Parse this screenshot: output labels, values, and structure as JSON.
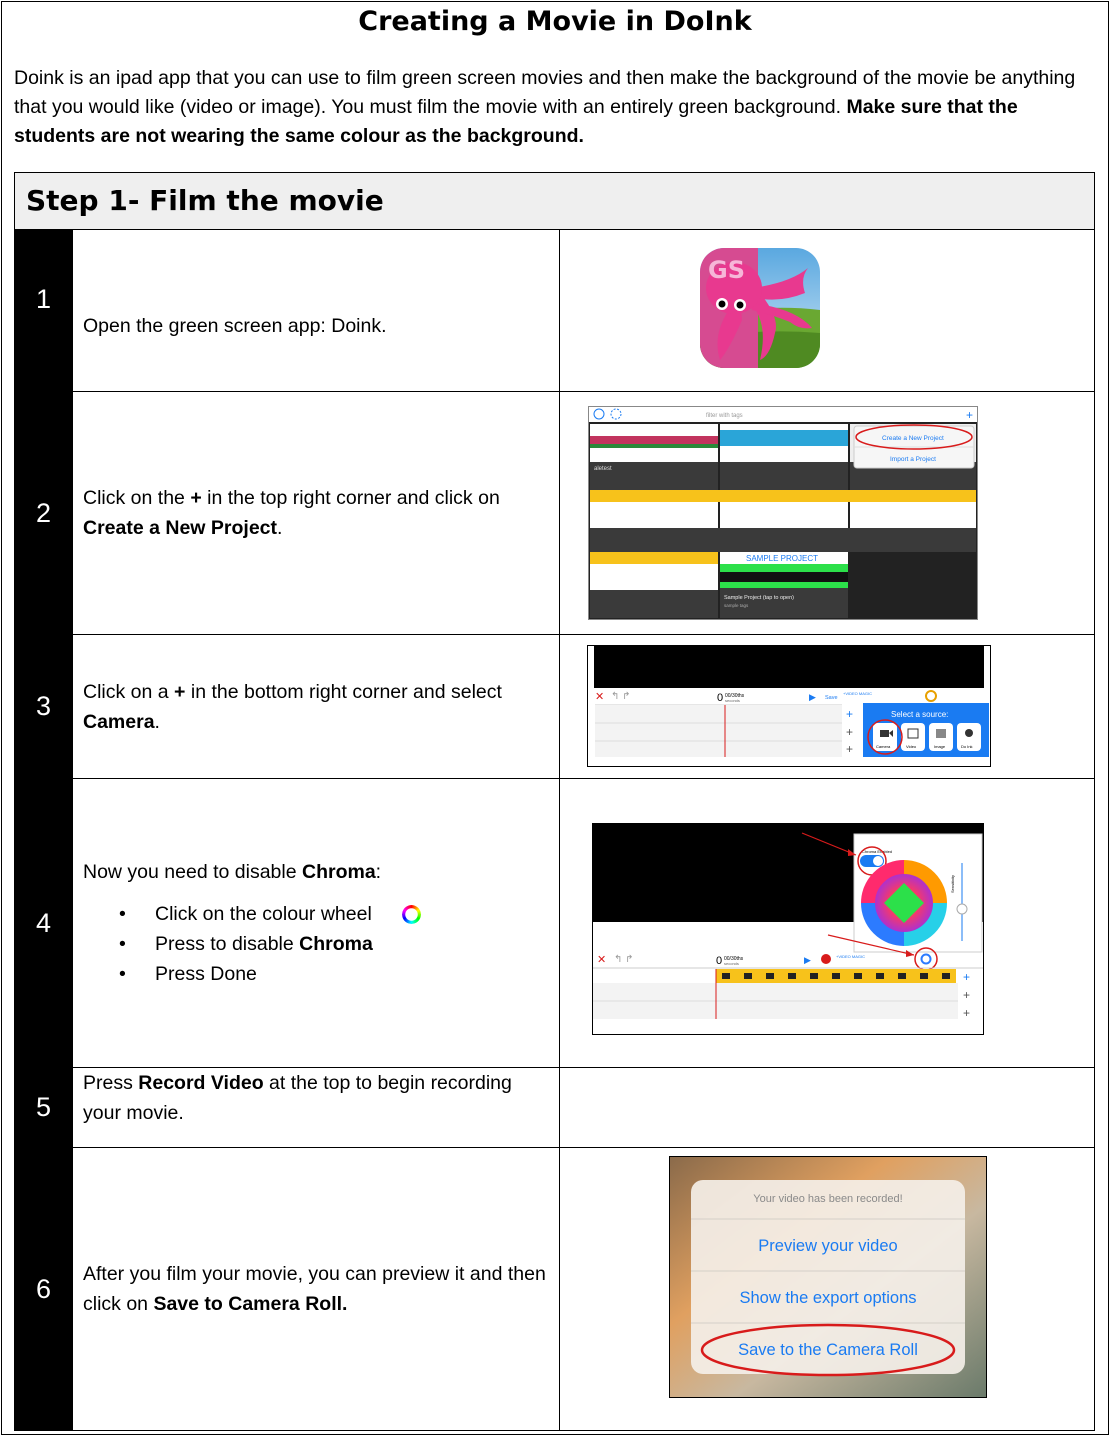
{
  "title": "Creating a Movie in DoInk",
  "intro": {
    "text": "Doink is an ipad app that you can use to film green screen movies and then make the background of the movie be anything that you would like (video or image). You must film the movie with an entirely green background.",
    "bold": "Make sure that the students are not wearing the same colour as the background."
  },
  "step_header": "Step 1- Film the movie",
  "steps": [
    {
      "num": "1",
      "text": "Open the green screen app: Doink."
    },
    {
      "num": "2",
      "pre": "Click on the ",
      "b1": "+",
      "mid": " in the top right corner and click on ",
      "b2": "Create a New Project",
      "post": "."
    },
    {
      "num": "3",
      "pre": "Click on a ",
      "b1": "+",
      "mid": " in the bottom right corner and select ",
      "b2": "Camera",
      "post": "."
    },
    {
      "num": "4",
      "pre": "Now you need to disable ",
      "b1": "Chroma",
      "post": ":",
      "bullets": {
        "b1": "Click on the colour wheel",
        "b2_pre": "Press to disable ",
        "b2_bold": "Chroma",
        "b3": "Press Done"
      }
    },
    {
      "num": "5",
      "pre": "Press ",
      "b1": "Record Video",
      "post": " at the top to begin recording your movie."
    },
    {
      "num": "6",
      "pre": "After you film your movie, you can preview it and then click on ",
      "b1": "Save to Camera Roll."
    }
  ],
  "screens": {
    "icon_text": "GS",
    "s2": {
      "search": "filter with tags",
      "menu_create": "Create a New Project",
      "menu_import": "Import a Project",
      "project_name": "aletest",
      "sample_banner": "SAMPLE PROJECT",
      "sample_caption": "Sample Project (tap to open)",
      "sample_tags": "sample tags"
    },
    "s3": {
      "time_big": "0",
      "time_small": "00/30ths",
      "time_sec": "seconds",
      "save": "Save",
      "video_magic": "+VIDEO MAGIC",
      "select_source": "Select a source:",
      "src_camera": "Camera",
      "src_video": "Video",
      "src_image": "Image",
      "src_doink": "Do Ink"
    },
    "s4": {
      "chroma_enabled": "Chroma Enabled",
      "sensitivity": "Sensitivity",
      "time_big": "0",
      "time_small": "00/30ths",
      "time_sec": "seconds",
      "video_magic": "+VIDEO MAGIC"
    },
    "s6": {
      "msg": "Your video has been recorded!",
      "opt1": "Preview your video",
      "opt2": "Show the export options",
      "opt3": "Save to the Camera Roll"
    }
  },
  "colors": {
    "accent_blue": "#1a7bf2",
    "annotation_red": "#d81b1b",
    "doink_pink": "#e8398f",
    "film_yellow": "#f7c21b"
  }
}
